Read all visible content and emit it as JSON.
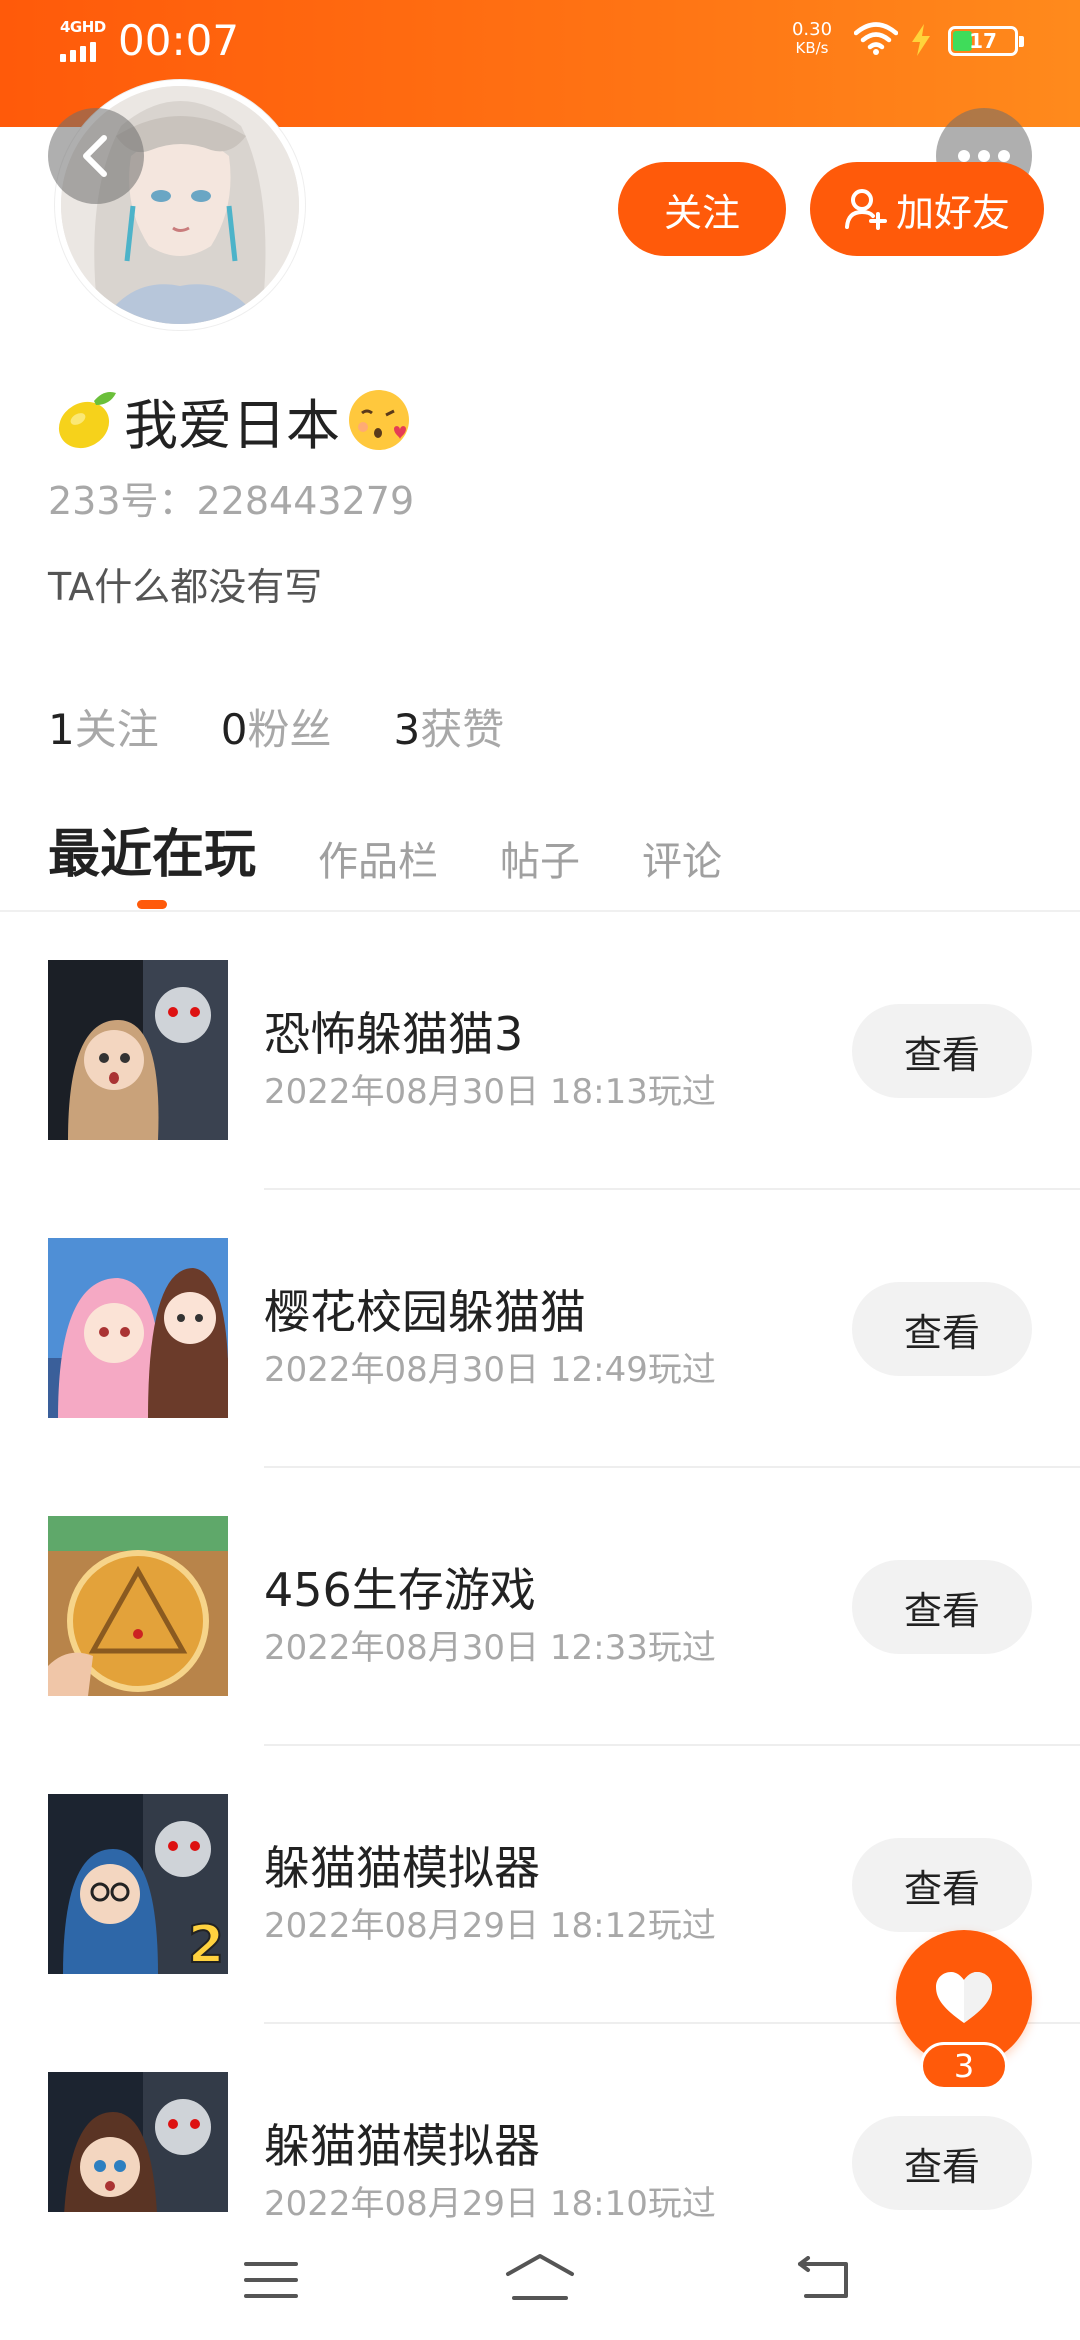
{
  "status_bar": {
    "network": "4GHD",
    "time": "00:07",
    "speed_value": "0.30",
    "speed_unit": "KB/s",
    "battery": "17"
  },
  "profile": {
    "username": "我爱日本",
    "uid_label": "233号：",
    "uid": "228443279",
    "bio": "TA什么都没有写",
    "follow_label": "关注",
    "add_friend_label": "加好友"
  },
  "stats": [
    {
      "value": "1",
      "label": "关注"
    },
    {
      "value": "0",
      "label": "粉丝"
    },
    {
      "value": "3",
      "label": "获赞"
    }
  ],
  "tabs": [
    {
      "label": "最近在玩",
      "active": true
    },
    {
      "label": "作品栏",
      "active": false
    },
    {
      "label": "帖子",
      "active": false
    },
    {
      "label": "评论",
      "active": false
    }
  ],
  "games": [
    {
      "title": "恐怖躲猫猫3",
      "played": "2022年08月30日 18:13玩过",
      "button": "查看"
    },
    {
      "title": "樱花校园躲猫猫",
      "played": "2022年08月30日 12:49玩过",
      "button": "查看"
    },
    {
      "title": "456生存游戏",
      "played": "2022年08月30日 12:33玩过",
      "button": "查看"
    },
    {
      "title": "躲猫猫模拟器",
      "played": "2022年08月29日 18:12玩过",
      "button": "查看"
    },
    {
      "title": "躲猫猫模拟器",
      "played": "2022年08月29日 18:10玩过",
      "button": "查看"
    }
  ],
  "like": {
    "count": "3"
  },
  "colors": {
    "accent": "#ff5a0a",
    "text": "#222222",
    "muted": "#a8a8a8"
  }
}
